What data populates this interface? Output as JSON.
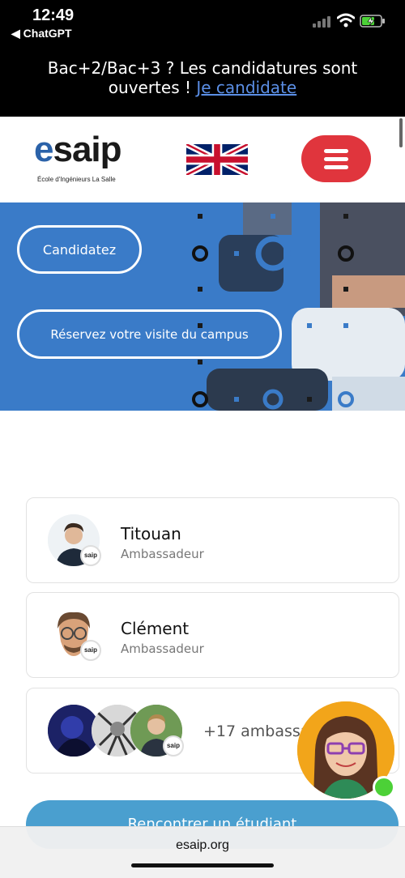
{
  "status_bar": {
    "time": "12:49",
    "back_app": "◀ ChatGPT"
  },
  "banner": {
    "line1": "Bac+2/Bac+3 ? Les candidatures sont",
    "line2": "ouvertes ! ",
    "link": "Je candidate"
  },
  "header": {
    "logo_e": "e",
    "logo_rest": "saip",
    "logo_tagline": "École d'Ingénieurs  La Salle",
    "flag_icon": "uk-flag-icon",
    "menu_icon": "hamburger-icon",
    "menu_color": "#e0353d"
  },
  "hero": {
    "apply_button": "Candidatez",
    "visit_button": "Réservez votre visite du campus",
    "bg_color": "#3a7bc8"
  },
  "ambassadors": [
    {
      "name": "Titouan",
      "role": "Ambassadeur",
      "badge": "saip"
    },
    {
      "name": "Clément",
      "role": "Ambassadeur",
      "badge": "saip"
    }
  ],
  "group_card": {
    "more_text": "+17 ambassadeurs",
    "badge": "saip"
  },
  "cta": {
    "label": "Rencontrer un étudiant"
  },
  "url_bar": {
    "url": "esaip.org"
  }
}
